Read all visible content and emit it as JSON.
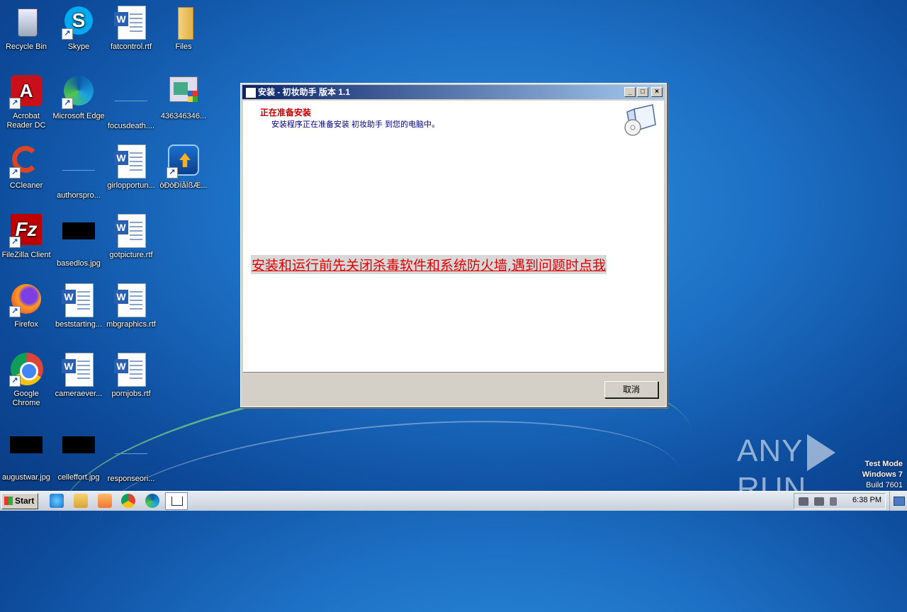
{
  "desktop": {
    "icons": [
      {
        "label": "Recycle Bin"
      },
      {
        "label": "Skype"
      },
      {
        "label": "fatcontrol.rtf"
      },
      {
        "label": "Files"
      },
      {
        "label": "Acrobat Reader DC"
      },
      {
        "label": "Microsoft Edge"
      },
      {
        "label": "focusdeath...."
      },
      {
        "label": "436346346..."
      },
      {
        "label": "CCleaner"
      },
      {
        "label": "authorspro..."
      },
      {
        "label": "girlopportun..."
      },
      {
        "label": "òÐòÐÎåÎßÆ..."
      },
      {
        "label": "FileZilla Client"
      },
      {
        "label": "basedlos.jpg"
      },
      {
        "label": "gotpicture.rtf"
      },
      {
        "label": "Firefox"
      },
      {
        "label": "beststarting..."
      },
      {
        "label": "mbgraphics.rtf"
      },
      {
        "label": "Google Chrome"
      },
      {
        "label": "cameraever..."
      },
      {
        "label": "pornjobs.rtf"
      },
      {
        "label": "augustwar.jpg"
      },
      {
        "label": "celleffort.jpg"
      },
      {
        "label": "responseori..."
      }
    ]
  },
  "installer": {
    "title": "安装 - 初妆助手 版本 1.1",
    "header_title": "正在准备安装",
    "header_subtitle": "安装程序正在准备安装 初妆助手 到您的电脑中。",
    "warning_link": "安装和运行前先关闭杀毒软件和系统防火墙,遇到问题时点我",
    "cancel_label": "取消",
    "controls": {
      "minimize": "_",
      "maximize": "□",
      "close": "×"
    }
  },
  "watermark": {
    "brand_left": "ANY",
    "brand_right": "RUN",
    "line1": "Test Mode",
    "line2": "Windows 7",
    "line3": "Build 7601"
  },
  "taskbar": {
    "start_label": "Start",
    "clock": "6:38 PM"
  },
  "colors": {
    "title_gradient_start": "#0a246a",
    "warning_red": "#e00000",
    "header_red": "#c00000"
  }
}
